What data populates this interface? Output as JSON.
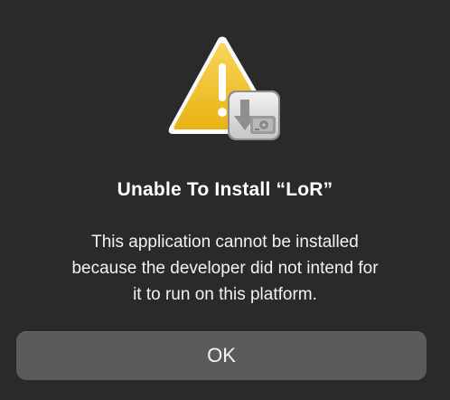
{
  "dialog": {
    "icon": "warning-triangle-with-installer-disk-icon",
    "title": "Unable To Install “LoR”",
    "message_lines": [
      "This application cannot be installed",
      "because the developer did not intend for",
      "it to run on this platform."
    ],
    "ok_label": "OK"
  },
  "colors": {
    "background": "#2a2a2c",
    "button": "#5b5b5d",
    "warning_yellow": "#f4c21a",
    "text": "#ffffff"
  }
}
